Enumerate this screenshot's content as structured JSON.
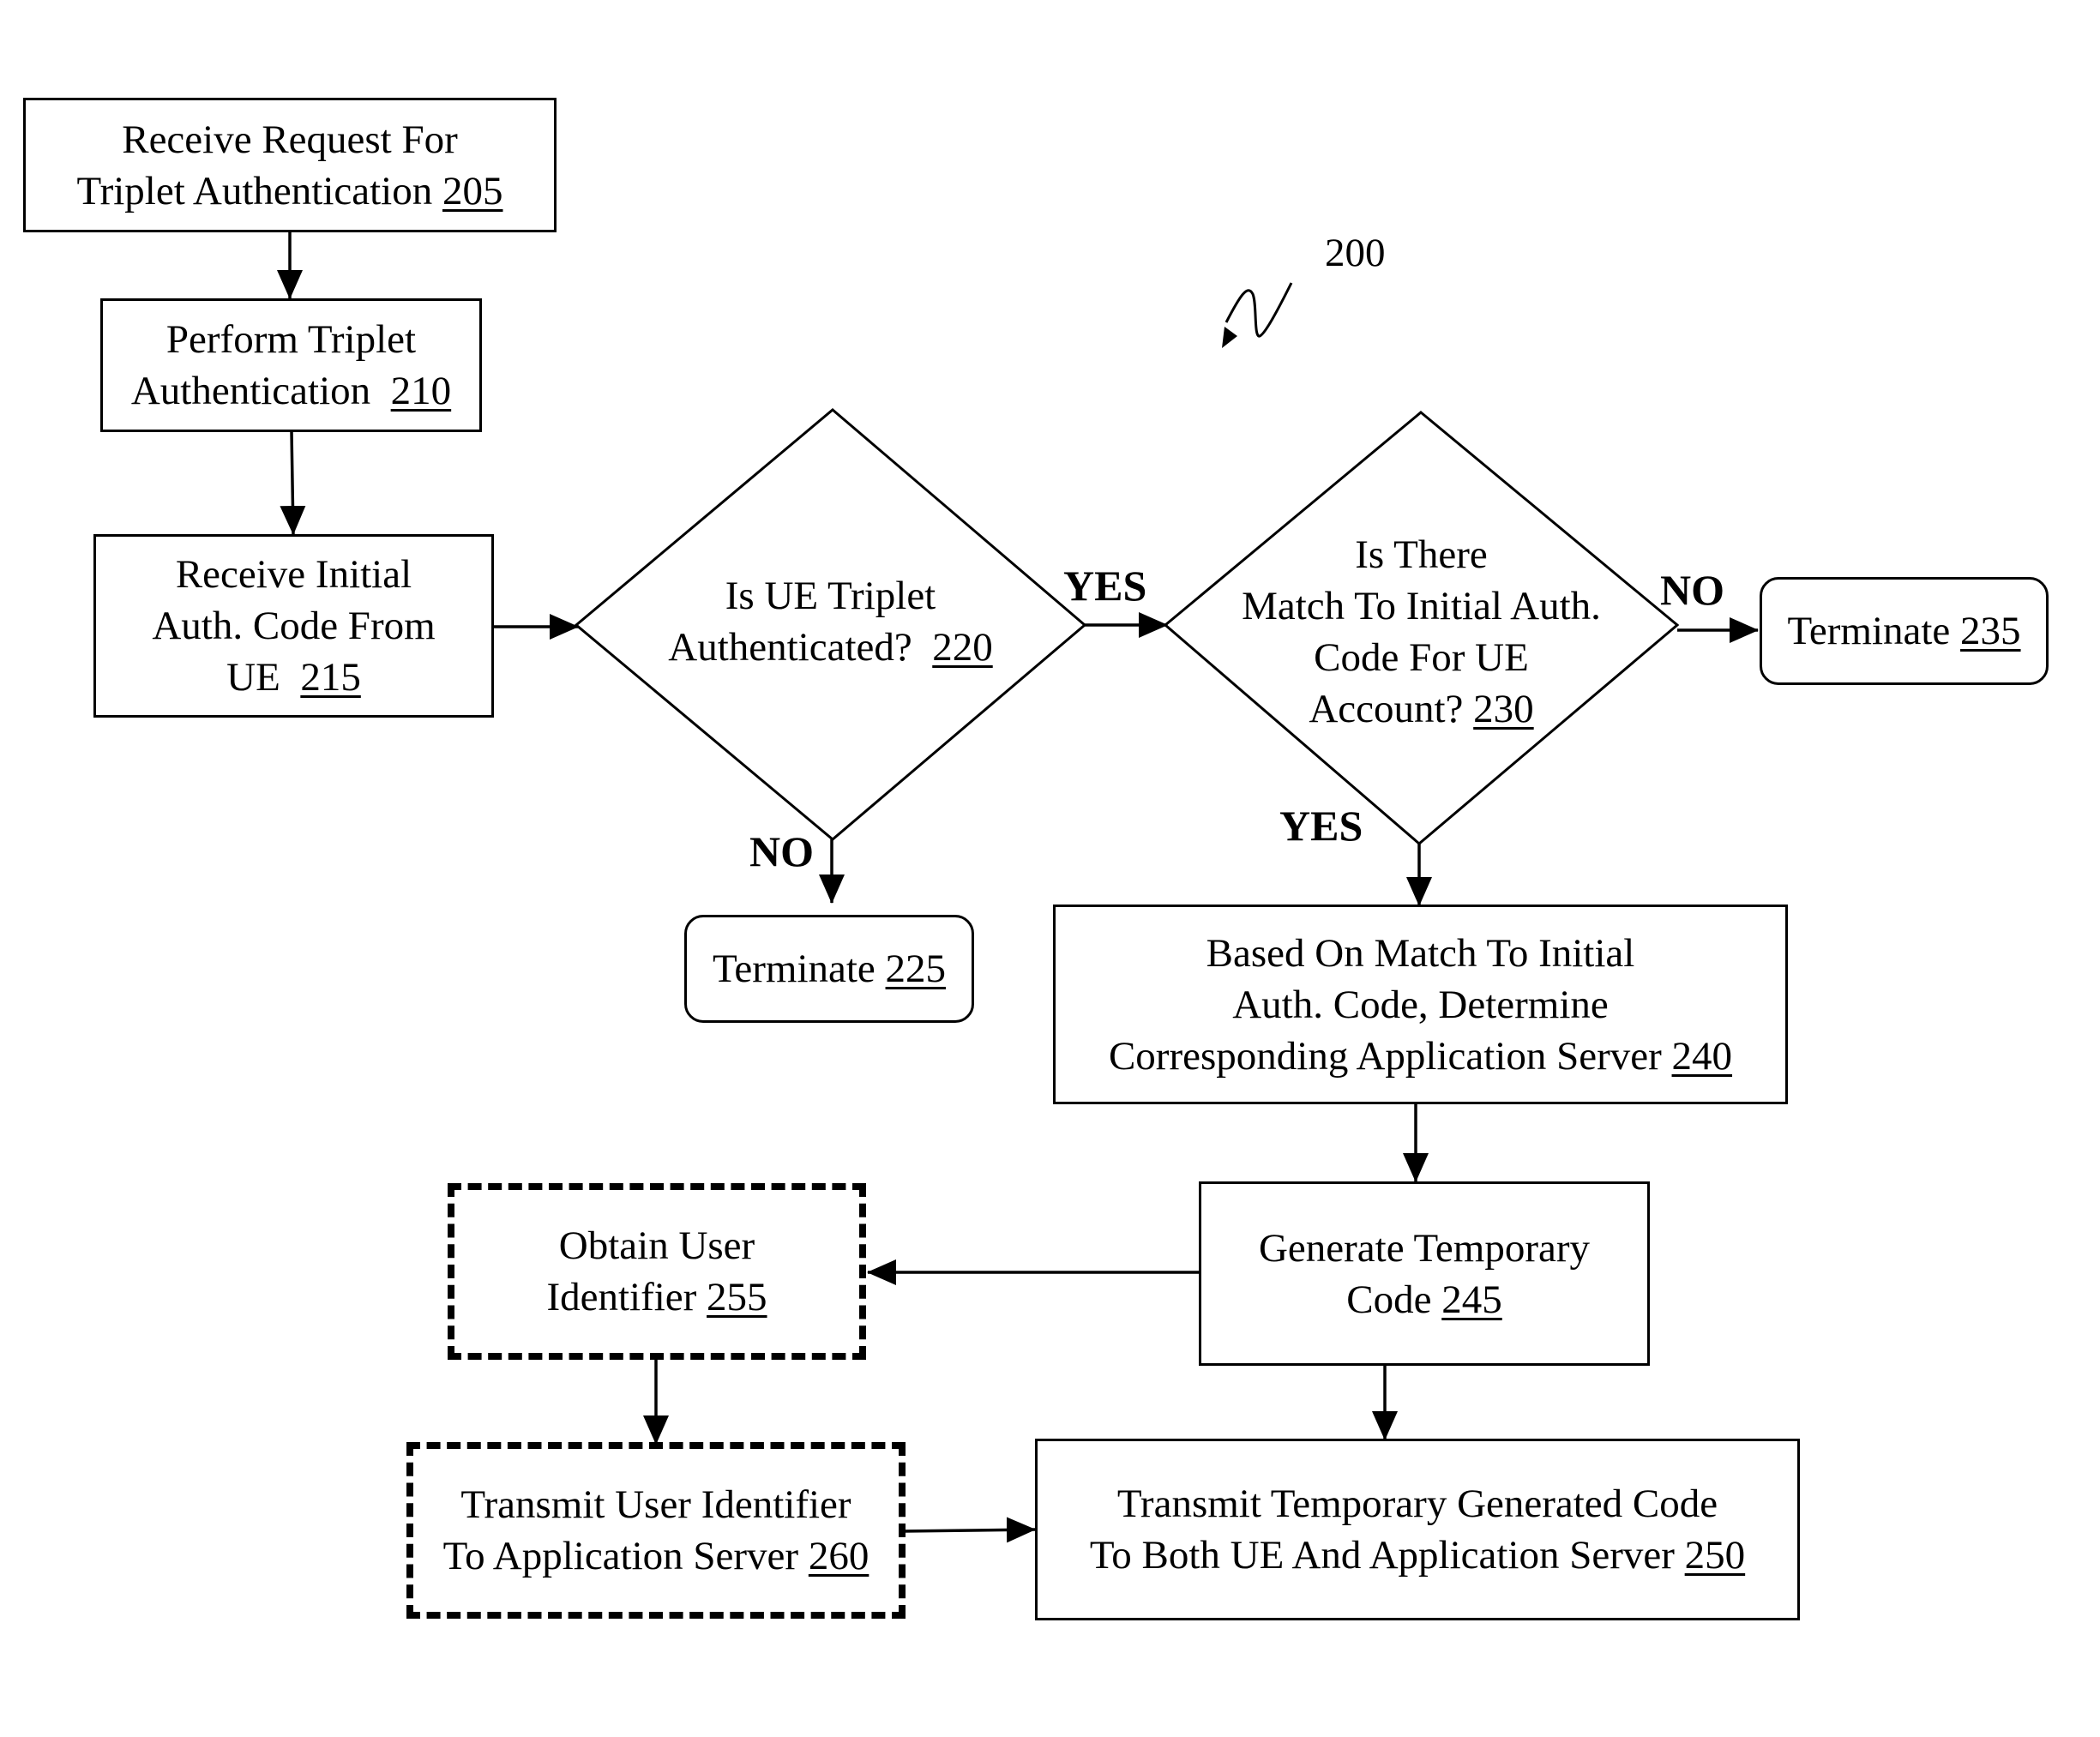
{
  "figure": {
    "reference_number": "200",
    "line_color": "#000000",
    "background_color": "#ffffff"
  },
  "nodes": {
    "n205": {
      "lines": [
        "Receive Request For",
        "Triplet Authentication"
      ],
      "ref": "205",
      "shape": "rectangle"
    },
    "n210": {
      "lines": [
        "Perform Triplet",
        "Authentication"
      ],
      "ref": "210",
      "shape": "rectangle"
    },
    "n215": {
      "lines": [
        "Receive Initial",
        "Auth. Code From",
        "UE"
      ],
      "ref": "215",
      "shape": "rectangle"
    },
    "n220": {
      "lines": [
        "Is UE Triplet",
        "Authenticated?"
      ],
      "ref": "220",
      "shape": "decision"
    },
    "n225": {
      "lines": [
        "Terminate"
      ],
      "ref": "225",
      "shape": "terminator"
    },
    "n230": {
      "lines": [
        "Is There",
        "Match To Initial Auth.",
        "Code For UE",
        "Account?"
      ],
      "ref": "230",
      "shape": "decision"
    },
    "n235": {
      "lines": [
        "Terminate"
      ],
      "ref": "235",
      "shape": "terminator"
    },
    "n240": {
      "lines": [
        "Based On Match To Initial",
        "Auth. Code, Determine",
        "Corresponding Application Server"
      ],
      "ref": "240",
      "shape": "rectangle"
    },
    "n245": {
      "lines": [
        "Generate Temporary",
        "Code"
      ],
      "ref": "245",
      "shape": "rectangle"
    },
    "n250": {
      "lines": [
        "Transmit Temporary Generated Code",
        "To Both UE And Application Server"
      ],
      "ref": "250",
      "shape": "rectangle"
    },
    "n255": {
      "lines": [
        "Obtain User",
        "Identifier"
      ],
      "ref": "255",
      "shape": "optional-dashed"
    },
    "n260": {
      "lines": [
        "Transmit User Identifier",
        "To Application Server"
      ],
      "ref": "260",
      "shape": "optional-dashed"
    }
  },
  "branch_labels": {
    "n220_yes": "YES",
    "n220_no": "NO",
    "n230_yes": "YES",
    "n230_no": "NO"
  },
  "edges": [
    {
      "from": "205",
      "to": "210",
      "label": ""
    },
    {
      "from": "210",
      "to": "215",
      "label": ""
    },
    {
      "from": "215",
      "to": "220",
      "label": ""
    },
    {
      "from": "220",
      "to": "230",
      "label": "YES"
    },
    {
      "from": "220",
      "to": "225",
      "label": "NO"
    },
    {
      "from": "230",
      "to": "235",
      "label": "NO"
    },
    {
      "from": "230",
      "to": "240",
      "label": "YES"
    },
    {
      "from": "240",
      "to": "245",
      "label": ""
    },
    {
      "from": "245",
      "to": "255",
      "label": ""
    },
    {
      "from": "245",
      "to": "250",
      "label": ""
    },
    {
      "from": "255",
      "to": "260",
      "label": ""
    },
    {
      "from": "260",
      "to": "250",
      "label": ""
    }
  ]
}
